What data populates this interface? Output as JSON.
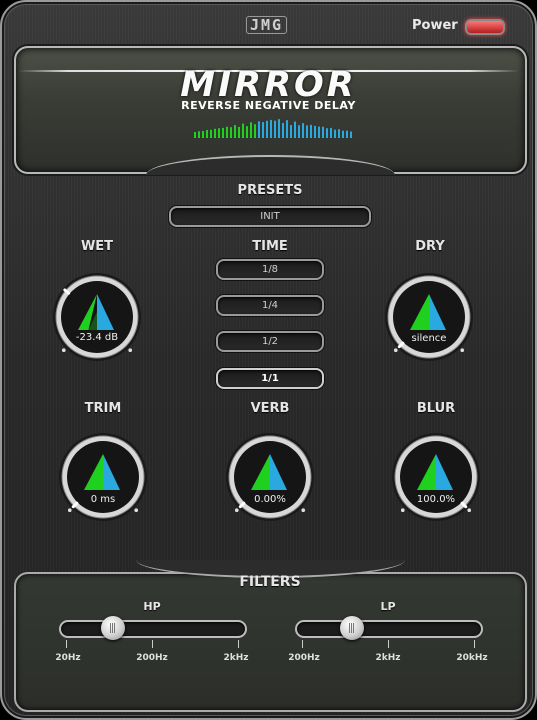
{
  "header": {
    "logo": "JMG",
    "power_label": "Power",
    "title": "MIRROR",
    "subtitle": "REVERSE NEGATIVE DELAY"
  },
  "presets": {
    "label": "PRESETS",
    "value": "INIT"
  },
  "time": {
    "label": "TIME",
    "options": [
      "1/8",
      "1/4",
      "1/2",
      "1/1"
    ],
    "selected": "1/1"
  },
  "knobs": {
    "wet": {
      "label": "WET",
      "value": "-23.4 dB"
    },
    "dry": {
      "label": "DRY",
      "value": "silence"
    },
    "trim": {
      "label": "TRIM",
      "value": "0 ms"
    },
    "verb": {
      "label": "VERB",
      "value": "0.00%"
    },
    "blur": {
      "label": "BLUR",
      "value": "100.0%"
    }
  },
  "filters": {
    "label": "FILTERS",
    "hp": {
      "label": "HP",
      "ticks": [
        "20Hz",
        "200Hz",
        "2kHz"
      ],
      "position": 0.28
    },
    "lp": {
      "label": "LP",
      "ticks": [
        "200Hz",
        "2kHz",
        "20kHz"
      ],
      "position": 0.3
    }
  },
  "colors": {
    "accent_green": "#1fd01f",
    "accent_blue": "#2aa8e0",
    "power_red": "#e03030"
  },
  "icons": [
    "power-toggle",
    "triangle-level-icon"
  ]
}
